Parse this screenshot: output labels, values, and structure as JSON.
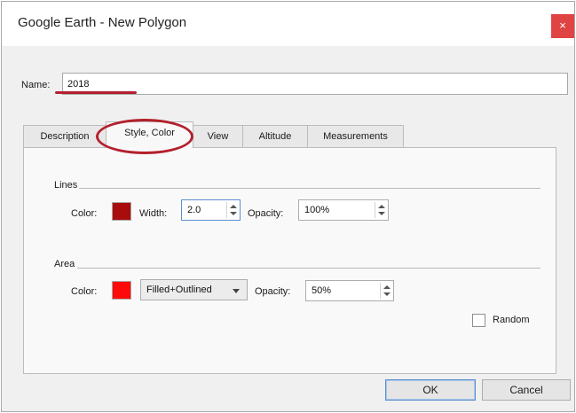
{
  "window": {
    "title": "Google Earth - New Polygon",
    "close_glyph": "×"
  },
  "name_field": {
    "label": "Name:",
    "value": "2018"
  },
  "tabs": [
    {
      "label": "Description",
      "active": false
    },
    {
      "label": "Style, Color",
      "active": true
    },
    {
      "label": "View",
      "active": false
    },
    {
      "label": "Altitude",
      "active": false
    },
    {
      "label": "Measurements",
      "active": false
    }
  ],
  "lines": {
    "group_label": "Lines",
    "color_label": "Color:",
    "color": "#a80c0c",
    "width_label": "Width:",
    "width_value": "2.0",
    "opacity_label": "Opacity:",
    "opacity_value": "100%"
  },
  "area": {
    "group_label": "Area",
    "color_label": "Color:",
    "color": "#ff0a0a",
    "fill_mode": "Filled+Outlined",
    "opacity_label": "Opacity:",
    "opacity_value": "50%"
  },
  "random": {
    "label": "Random",
    "checked": false
  },
  "buttons": {
    "ok": "OK",
    "cancel": "Cancel"
  },
  "annotation_color": "#b3202d",
  "icons": {
    "close": "close-icon",
    "spin_up": "chevron-up-icon",
    "spin_down": "chevron-down-icon",
    "dropdown": "caret-down-icon"
  }
}
